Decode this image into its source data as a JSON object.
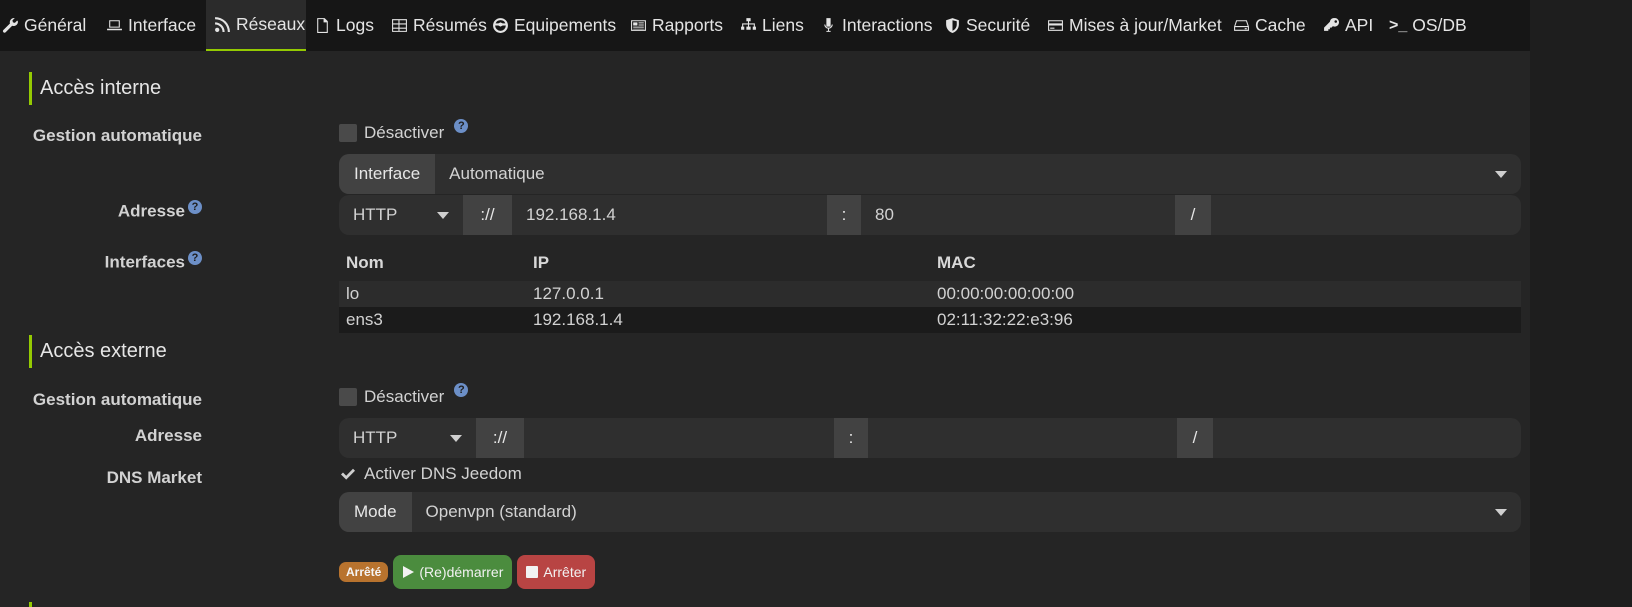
{
  "tabs": [
    {
      "label": "Général",
      "icon": "wrench-icon"
    },
    {
      "label": "Interface",
      "icon": "laptop-icon"
    },
    {
      "label": "Réseaux",
      "icon": "rss-icon",
      "active": true
    },
    {
      "label": "Logs",
      "icon": "file-icon"
    },
    {
      "label": "Résumés",
      "icon": "table-icon"
    },
    {
      "label": "Equipements",
      "icon": "cube-icon"
    },
    {
      "label": "Rapports",
      "icon": "newspaper-icon"
    },
    {
      "label": "Liens",
      "icon": "sitemap-icon"
    },
    {
      "label": "Interactions",
      "icon": "microphone-icon"
    },
    {
      "label": "Securité",
      "icon": "shield-icon"
    },
    {
      "label": "Mises à jour/Market",
      "icon": "credit-card-icon"
    },
    {
      "label": "Cache",
      "icon": "hdd-icon"
    },
    {
      "label": "API",
      "icon": "key-icon"
    },
    {
      "label": "OS/DB",
      "icon": "terminal-icon"
    }
  ],
  "internal": {
    "title": "Accès interne",
    "auto_label": "Gestion automatique",
    "auto_checkbox": "Désactiver",
    "interface_addon": "Interface",
    "interface_value": "Automatique",
    "address_label": "Adresse",
    "protocol": "HTTP",
    "sep_scheme": "://",
    "host": "192.168.1.4",
    "sep_port": ":",
    "port": "80",
    "sep_path": "/",
    "path": "",
    "interfaces_label": "Interfaces",
    "table": {
      "headers": [
        "Nom",
        "IP",
        "MAC"
      ],
      "rows": [
        [
          "lo",
          "127.0.0.1",
          "00:00:00:00:00:00"
        ],
        [
          "ens3",
          "192.168.1.4",
          "02:11:32:22:e3:96"
        ]
      ]
    }
  },
  "external": {
    "title": "Accès externe",
    "auto_label": "Gestion automatique",
    "auto_checkbox": "Désactiver",
    "address_label": "Adresse",
    "protocol": "HTTP",
    "sep_scheme": "://",
    "host": "",
    "sep_port": ":",
    "port": "",
    "sep_path": "/",
    "path": "",
    "dns_label": "DNS Market",
    "dns_checkbox": "Activer DNS Jeedom",
    "dns_checked": true,
    "mode_addon": "Mode",
    "mode_value": "Openvpn (standard)",
    "status_badge": "Arrêté",
    "restart_button": "(Re)démarrer",
    "stop_button": "Arrêter"
  },
  "colors": {
    "accent": "#94ca02",
    "badge": "#b8732e",
    "green": "#4b8c3e",
    "red": "#b84443",
    "help": "#6c8fc7"
  }
}
